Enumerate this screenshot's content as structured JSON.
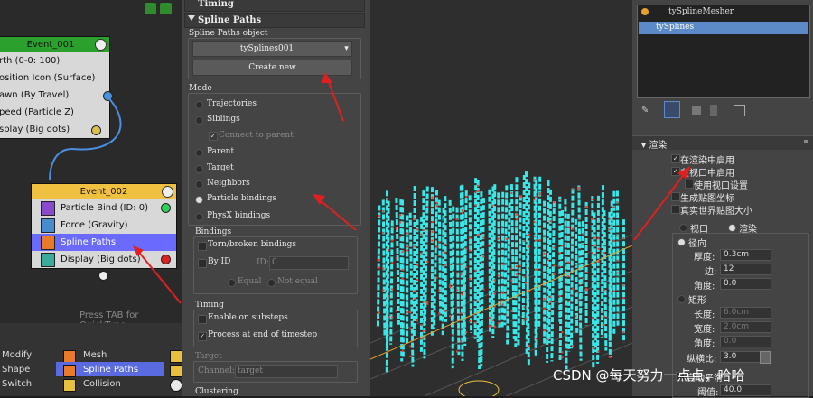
{
  "graph": {
    "event1": {
      "title": "Event_001",
      "rows": [
        "rth (0-0: 100)",
        "osition Icon (Surface)",
        "awn (By Travel)",
        "peed (Particle Z)",
        "splay (Big dots)"
      ]
    },
    "event2": {
      "title": "Event_002",
      "rows": [
        "Particle Bind (ID: 0)",
        "Force (Gravity)",
        "Spline Paths",
        "Display (Big dots)"
      ]
    },
    "hint": "Press TAB for QuickType"
  },
  "depot": {
    "left": [
      "Modify",
      "Shape",
      "Switch"
    ],
    "right": [
      "Mesh",
      "Spline Paths",
      "Collision"
    ]
  },
  "panel": {
    "timing_header": "Timing",
    "spline_header": "Spline Paths",
    "object_group": "Spline Paths object",
    "object_value": "tySplines001",
    "create_btn": "Create new",
    "mode_group": "Mode",
    "modes": [
      "Trajectories",
      "Siblings",
      "Connect to parent",
      "Parent",
      "Target",
      "Neighbors",
      "Particle bindings",
      "PhysX bindings"
    ],
    "bindings_group": "Bindings",
    "torn": "Torn/broken bindings",
    "byid": "By ID",
    "id_label": "ID:",
    "id_value": "0",
    "equal": "Equal",
    "notequal": "Not equal",
    "timing_group": "Timing",
    "substeps": "Enable on substeps",
    "process_end": "Process at end of timestep",
    "target_group": "Target",
    "channel_label": "Channel:",
    "channel_value": "target",
    "clustering": "Clustering"
  },
  "stack": {
    "items": [
      "tySplineMesher",
      "tySplines"
    ],
    "selected": 1
  },
  "render": {
    "header": "渲染",
    "enable_render": "在渲染中启用",
    "enable_viewport": "在视口中启用",
    "use_viewport": "使用视口设置",
    "gen_mapping": "生成贴图坐标",
    "real_world": "真实世界贴图大小",
    "viewport": "视口",
    "render": "渲染",
    "radial": "径向",
    "thickness_label": "厚度:",
    "thickness": "0.3cm",
    "sides_label": "边:",
    "sides": "12",
    "angle_label": "角度:",
    "angle": "0.0",
    "rect": "矩形",
    "length_label": "长度:",
    "length": "6.0cm",
    "width_label": "宽度:",
    "width": "2.0cm",
    "angle2_label": "角度:",
    "angle2": "0.0",
    "aspect_label": "纵横比:",
    "aspect": "3.0",
    "auto_smooth": "自动平滑",
    "threshold_label": "阈值:",
    "threshold": "40.0"
  },
  "watermark": "CSDN @每天努力一点点，哈哈",
  "colors": {
    "event_header": "#f0c040",
    "node_body": "#d8d8d8",
    "selected_row": "#6a6aff",
    "spline": "#38e8e8",
    "accent": "#5c8ac8"
  }
}
